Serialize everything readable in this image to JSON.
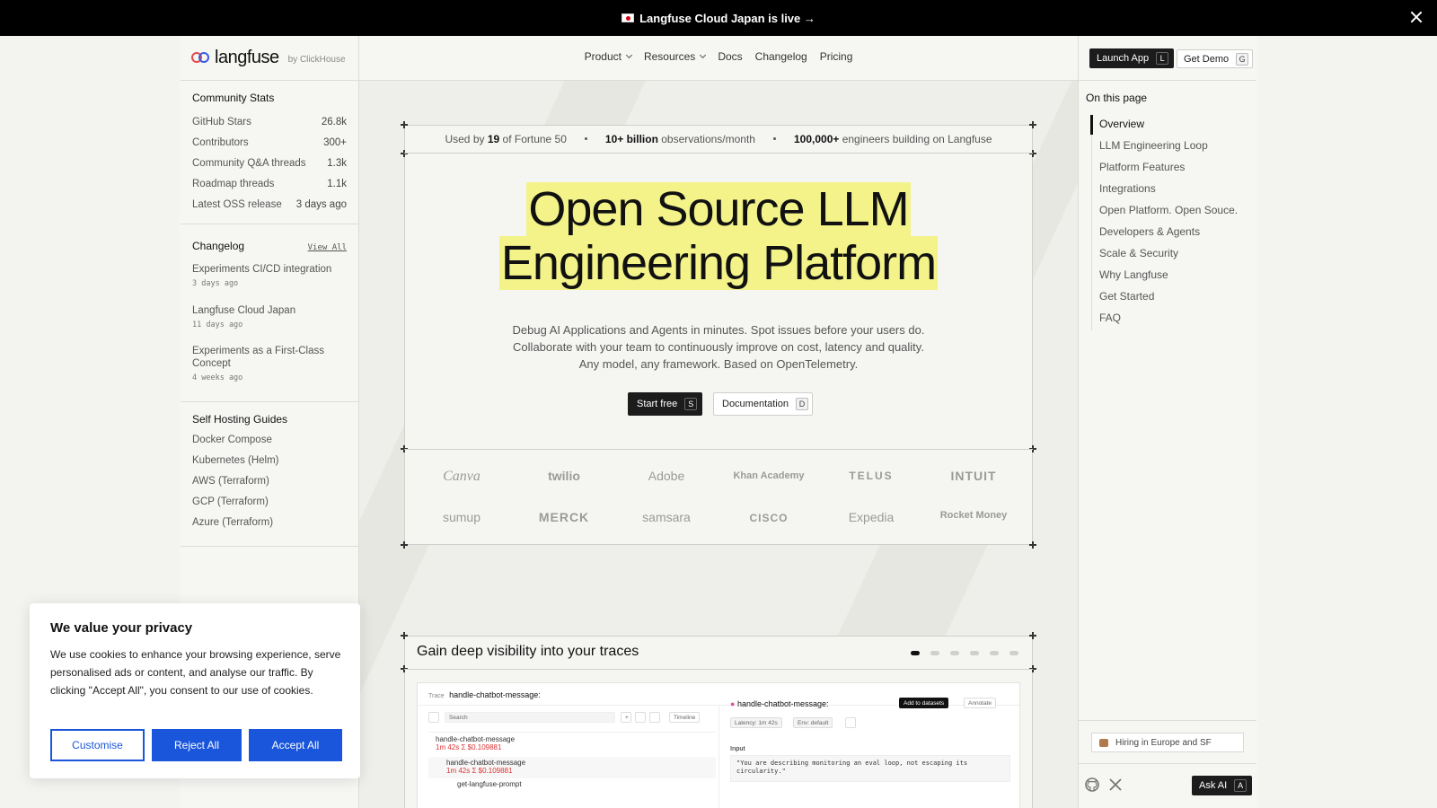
{
  "announcement": {
    "text": "Langfuse Cloud Japan is live →"
  },
  "brand": {
    "name": "langfuse",
    "by": "by ClickHouse"
  },
  "nav": {
    "items": [
      {
        "label": "Product",
        "dropdown": true
      },
      {
        "label": "Resources",
        "dropdown": true
      },
      {
        "label": "Docs",
        "dropdown": false
      },
      {
        "label": "Changelog",
        "dropdown": false
      },
      {
        "label": "Pricing",
        "dropdown": false
      }
    ],
    "launch_app": {
      "label": "Launch App",
      "key": "L"
    },
    "get_demo": {
      "label": "Get Demo",
      "key": "G"
    }
  },
  "community_stats": {
    "title": "Community Stats",
    "rows": [
      {
        "label": "GitHub Stars",
        "value": "26.8k"
      },
      {
        "label": "Contributors",
        "value": "300+"
      },
      {
        "label": "Community Q&A threads",
        "value": "1.3k"
      },
      {
        "label": "Roadmap threads",
        "value": "1.1k"
      },
      {
        "label": "Latest OSS release",
        "value": "3 days ago"
      }
    ]
  },
  "changelog": {
    "title": "Changelog",
    "view_all": "View All",
    "items": [
      {
        "title": "Experiments CI/CD integration",
        "date": "3 days ago"
      },
      {
        "title": "Langfuse Cloud Japan",
        "date": "11 days ago"
      },
      {
        "title": "Experiments as a First-Class Concept",
        "date": "4 weeks ago"
      }
    ]
  },
  "self_hosting": {
    "title": "Self Hosting Guides",
    "items": [
      "Docker Compose",
      "Kubernetes (Helm)",
      "AWS (Terraform)",
      "GCP (Terraform)",
      "Azure (Terraform)"
    ]
  },
  "toc": {
    "title": "On this page",
    "items": [
      "Overview",
      "LLM Engineering Loop",
      "Platform Features",
      "Integrations",
      "Open Platform. Open Souce.",
      "Developers & Agents",
      "Scale & Security",
      "Why Langfuse",
      "Get Started",
      "FAQ"
    ],
    "active_index": 0
  },
  "hiring": {
    "label": "Hiring in Europe and SF"
  },
  "ask_ai": {
    "label": "Ask AI",
    "key": "A"
  },
  "stats_strip": {
    "s1_pre": "Used by ",
    "s1_bold": "19",
    "s1_post": " of Fortune 50",
    "s2_bold": "10+ billion",
    "s2_post": " observations/month",
    "s3_bold": "100,000+",
    "s3_post": " engineers building on Langfuse"
  },
  "hero": {
    "title_line1": "Open Source LLM",
    "title_line2": "Engineering Platform",
    "subtitle_line1": "Debug AI Applications and Agents in minutes. Spot issues before your users do.",
    "subtitle_line2": "Collaborate with your team to continuously improve on cost, latency and quality.",
    "subtitle_line3": "Any model, any framework. Based on OpenTelemetry.",
    "start_free": {
      "label": "Start free",
      "key": "S"
    },
    "documentation": {
      "label": "Documentation",
      "key": "D"
    },
    "highlight_color": "#f3f38a"
  },
  "customer_logos": [
    "Canva",
    "twilio",
    "Adobe",
    "Khan Academy",
    "TELUS",
    "INTUIT",
    "sumup",
    "MERCK",
    "samsara",
    "CISCO",
    "Expedia",
    "Rocket Money"
  ],
  "trace_section": {
    "title": "Gain deep visibility into your traces",
    "dots": 6,
    "active_dot": 0,
    "screenshot": {
      "trace_label": "Trace",
      "trace_name": "handle-chatbot-message:",
      "search_placeholder": "Search",
      "timeline": "Timeline",
      "panel_title": "handle-chatbot-message:",
      "add_to_datasets": "Add to datasets",
      "annotate": "Annotate",
      "latency": "Latency: 1m 42s",
      "env": "Env: default",
      "input_label": "Input",
      "input_text": "\"You are describing monitoring an eval loop, not escaping its circularity.\"",
      "tree": [
        {
          "name": "handle-chatbot-message",
          "meta": "1m 42s Σ $0.109881"
        },
        {
          "name": "handle-chatbot-message",
          "meta": "1m 42s Σ $0.109881"
        },
        {
          "name": "get-langfuse-prompt",
          "meta": ""
        }
      ]
    }
  },
  "cookie": {
    "title": "We value your privacy",
    "body": "We use cookies to enhance your browsing experience, serve personalised ads or content, and analyse our traffic. By clicking \"Accept All\", you consent to our use of cookies.",
    "customise": "Customise",
    "reject": "Reject All",
    "accept": "Accept All",
    "accent": "#1a56db"
  }
}
